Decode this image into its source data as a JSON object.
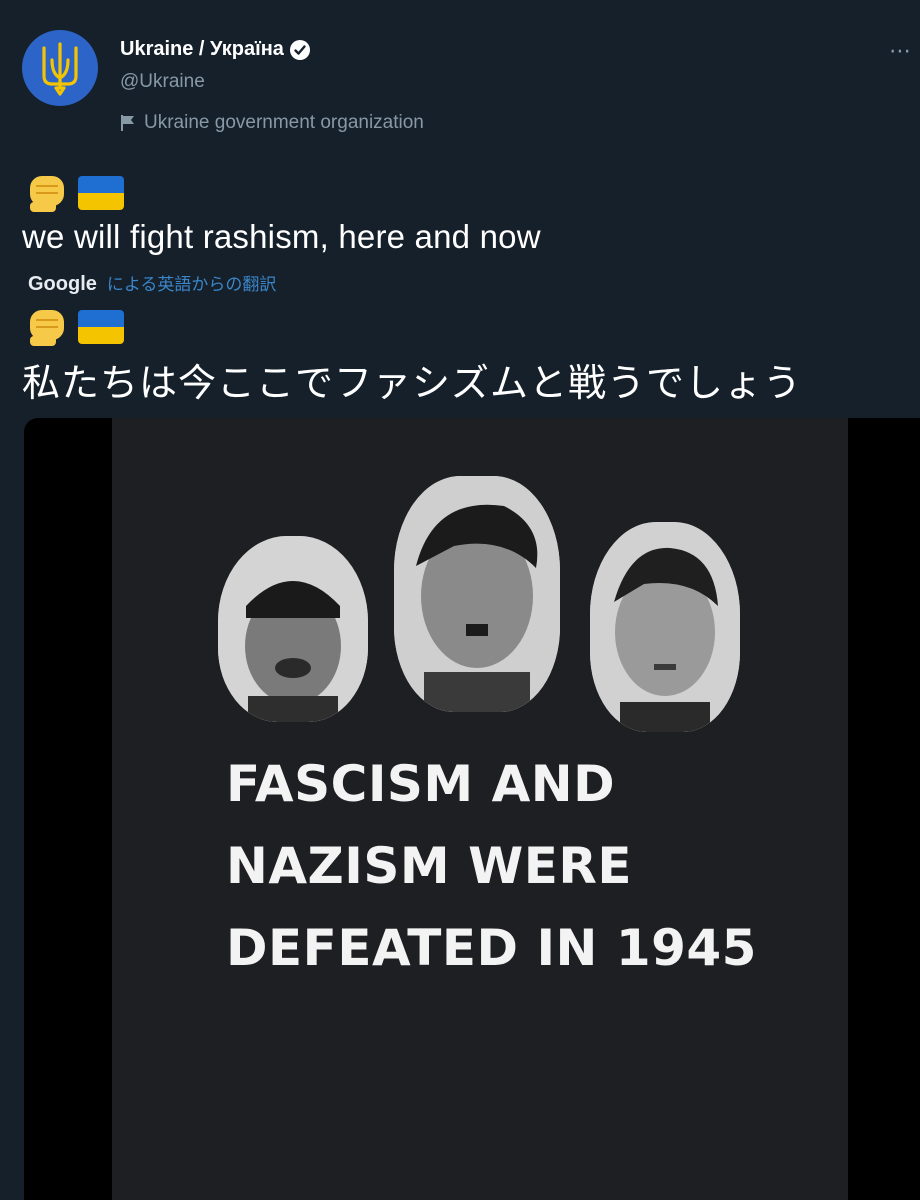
{
  "header": {
    "display_name": "Ukraine / Україна",
    "handle": "@Ukraine",
    "org_label": "Ukraine government organization"
  },
  "tweet": {
    "emoji": [
      "raised-fist",
      "ukraine-flag"
    ],
    "text": "we will fight rashism, here and now",
    "translation_provider": "Google",
    "translation_note": "による英語からの翻訳",
    "translated_text": "私たちは今ここでファシズムと戦うでしょう"
  },
  "media": {
    "caption_lines": [
      "FASCISM AND",
      "NAZISM WERE",
      "DEFEATED IN 1945"
    ],
    "portraits": [
      "portrait-left",
      "portrait-center",
      "portrait-right"
    ]
  },
  "colors": {
    "background": "#15202b",
    "secondary_text": "#8899a6",
    "link": "#3b85c9",
    "flag_blue": "#1f6ed1",
    "flag_yellow": "#f4c400"
  }
}
